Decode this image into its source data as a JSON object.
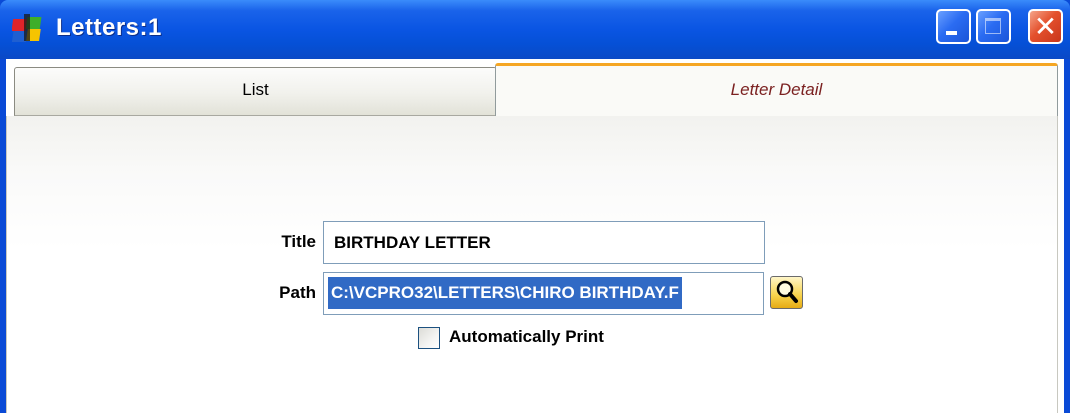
{
  "window": {
    "title": "Letters:1"
  },
  "tabs": [
    {
      "label": "List",
      "active": false
    },
    {
      "label": "Letter Detail",
      "active": true
    }
  ],
  "form": {
    "title_label": "Title",
    "title_value": "BIRTHDAY LETTER",
    "path_label": "Path",
    "path_value": "C:\\VCPRO32\\LETTERS\\CHIRO BIRTHDAY.F",
    "auto_print_label": "Automatically Print",
    "auto_print_checked": false
  },
  "icons": {
    "app": "app-logo-icon",
    "browse": "magnifier-icon",
    "minimize": "minimize-icon",
    "maximize": "maximize-icon",
    "close": "close-icon"
  },
  "colors": {
    "titlebar": "#0a55e3",
    "active_tab_accent": "#f5a623",
    "active_tab_text": "#7b2121",
    "selection": "#316ac5"
  }
}
